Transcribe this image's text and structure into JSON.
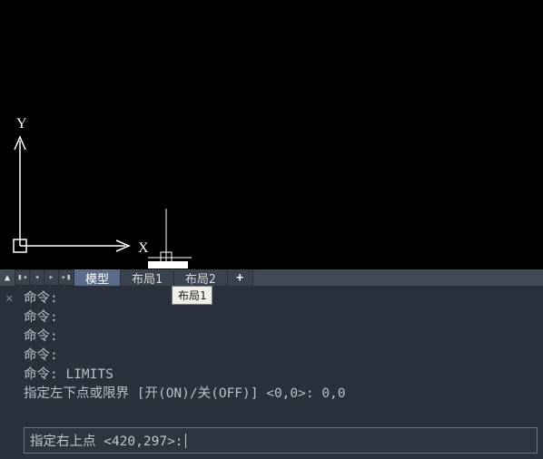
{
  "viewport": {
    "ucs": {
      "x_label": "X",
      "y_label": "Y"
    }
  },
  "tabs": {
    "items": [
      {
        "label": "模型",
        "active": true
      },
      {
        "label": "布局1",
        "active": false
      },
      {
        "label": "布局2",
        "active": false
      }
    ],
    "add_label": "+",
    "tooltip": "布局1"
  },
  "command": {
    "history": [
      "命令:",
      "命令:",
      "命令:",
      "命令:",
      "命令: LIMITS",
      "指定左下点或限界 [开(ON)/关(OFF)] <0,0>: 0,0"
    ],
    "prompt": "指定右上点 <420,297>: ",
    "input_value": ""
  }
}
